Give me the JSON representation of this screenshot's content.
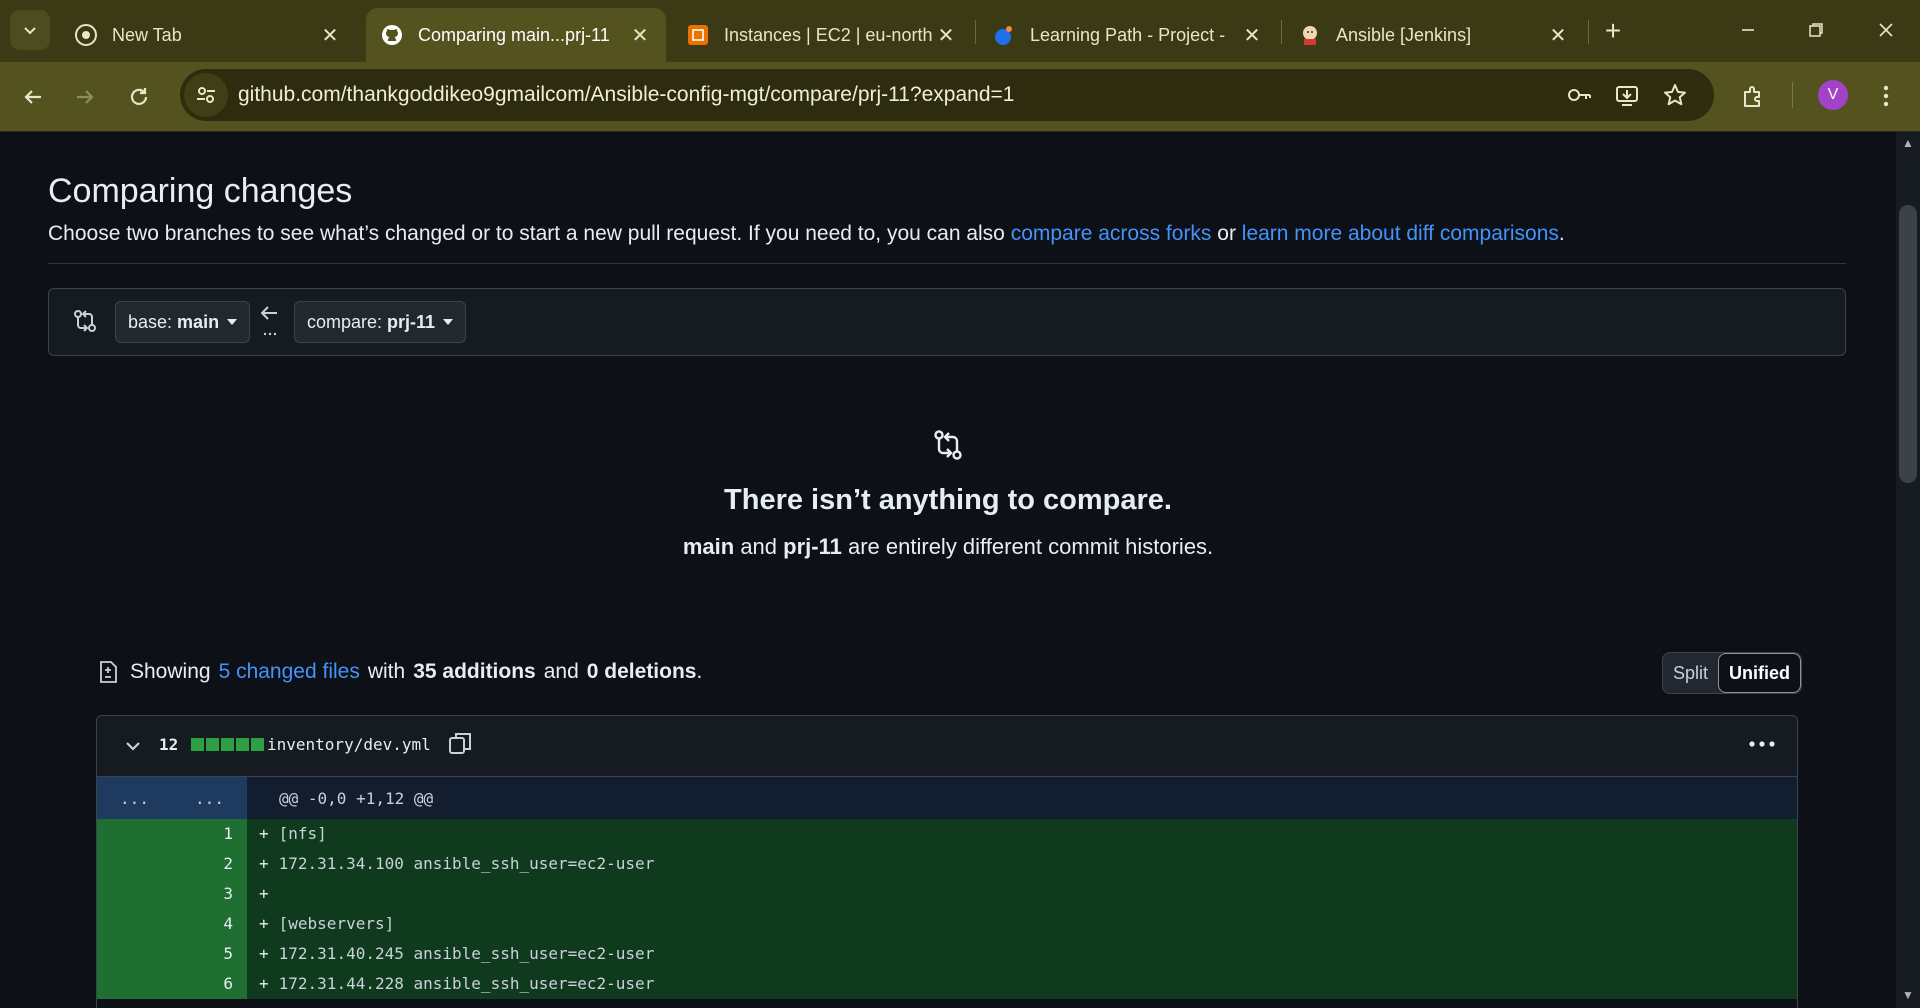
{
  "browser": {
    "tabs": [
      {
        "title": "New Tab",
        "icon": "chrome-icon"
      },
      {
        "title": "Comparing main...prj-11",
        "icon": "github-icon",
        "active": true
      },
      {
        "title": "Instances | EC2 | eu-north",
        "icon": "aws-ec2-icon"
      },
      {
        "title": "Learning Path - Project -",
        "icon": "darey-icon"
      },
      {
        "title": "Ansible [Jenkins]",
        "icon": "jenkins-icon"
      }
    ],
    "url": "github.com/thankgoddikeo9gmailcom/Ansible-config-mgt/compare/prj-11?expand=1",
    "profile_initial": "V",
    "colors": {
      "frame": "#3b3a14",
      "toolbar": "#545320",
      "omnibox": "#2d2c0f",
      "avatar": "#a142c9"
    }
  },
  "page": {
    "title": "Comparing changes",
    "lead": {
      "text_before": "Choose two branches to see what’s changed or to start a new pull request. If you need to, you can also ",
      "link1": "compare across forks",
      "text_mid": " or ",
      "link2": "learn more about diff comparisons",
      "text_after": "."
    },
    "range": {
      "base_label": "base:",
      "base_branch": "main",
      "compare_label": "compare:",
      "compare_branch": "prj-11"
    },
    "blankslate": {
      "title": "There isn’t anything to compare.",
      "branch_a": "main",
      "and": "and",
      "branch_b": "prj-11",
      "suffix": "are entirely different commit histories."
    },
    "toc": {
      "showing": "Showing",
      "changed_files": "5 changed files",
      "with": "with",
      "additions": "35 additions",
      "and": "and",
      "deletions": "0 deletions",
      "period": "."
    },
    "view_toggle": {
      "split": "Split",
      "unified": "Unified",
      "selected": "Unified"
    },
    "file": {
      "change_count": "12",
      "name": "inventory/dev.yml",
      "hunk_gutter_old": "...",
      "hunk_gutter_new": "...",
      "hunk_header": "@@ -0,0 +1,12 @@",
      "lines": [
        {
          "num": "1",
          "text": "[nfs]"
        },
        {
          "num": "2",
          "text": "172.31.34.100 ansible_ssh_user=ec2-user"
        },
        {
          "num": "3",
          "text": ""
        },
        {
          "num": "4",
          "text": "[webservers]"
        },
        {
          "num": "5",
          "text": "172.31.40.245 ansible_ssh_user=ec2-user"
        },
        {
          "num": "6",
          "text": "172.31.44.228 ansible_ssh_user=ec2-user"
        }
      ],
      "plus_sign": "+"
    },
    "colors": {
      "link": "#4493f8",
      "addition_gutter": "#1f6f32",
      "addition_bg": "#0f3a1d",
      "hunk_gutter": "#1f3a5f"
    }
  }
}
